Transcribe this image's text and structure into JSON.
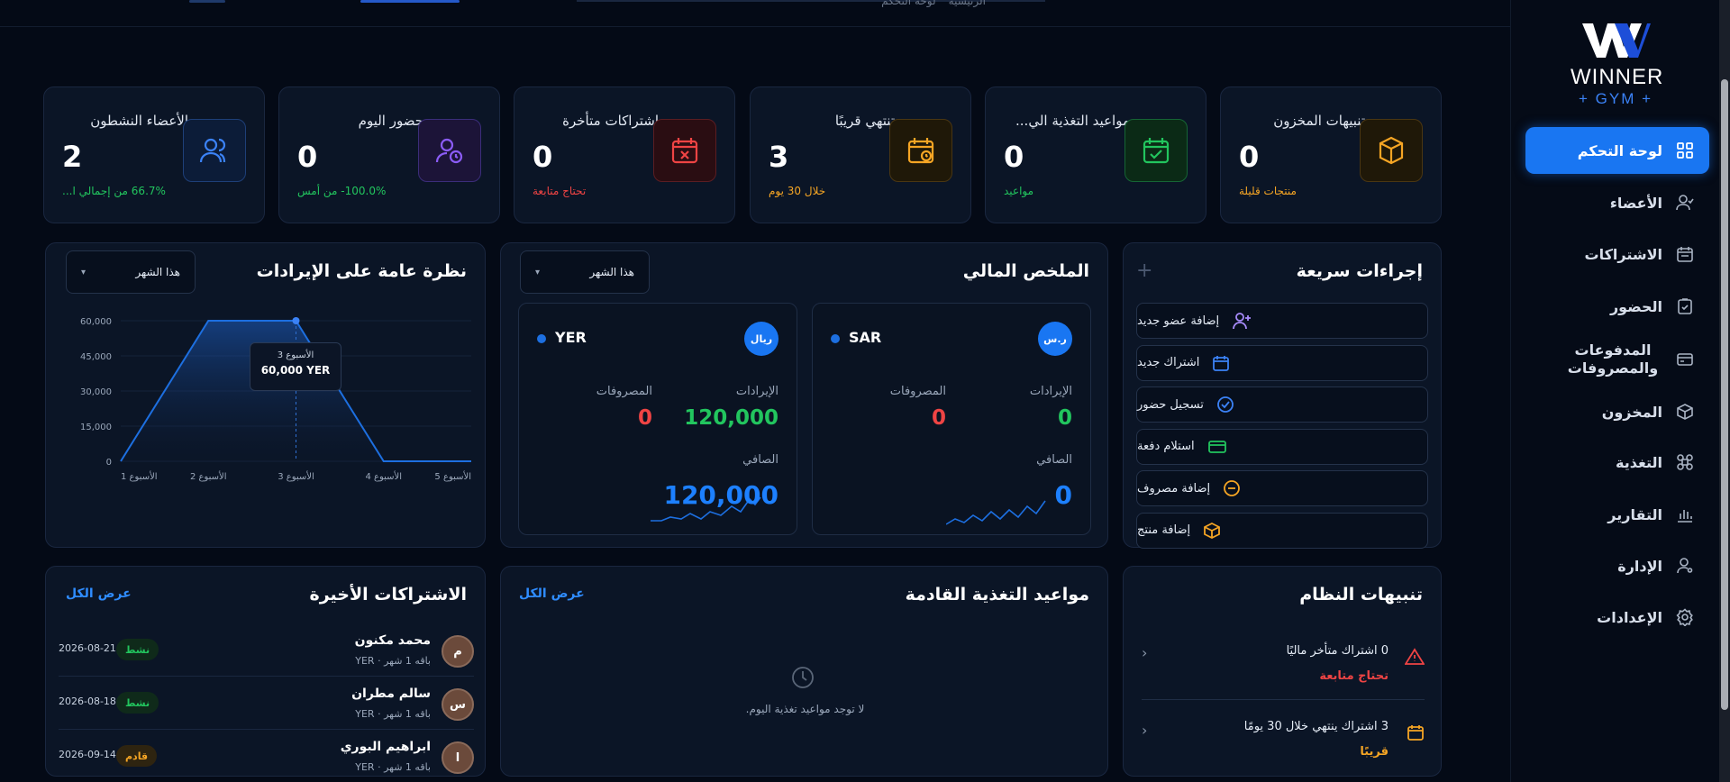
{
  "brand": {
    "logo_text": "WINNER",
    "logo_sub": "+ GYM +"
  },
  "topbar": {
    "breadcrumb_home": "الرئيسية",
    "breadcrumb_current": "لوحة التحكم"
  },
  "sidebar": {
    "items": [
      {
        "label": "لوحة التحكم",
        "icon": "grid-icon"
      },
      {
        "label": "الأعضاء",
        "icon": "user-icon"
      },
      {
        "label": "الاشتراكات",
        "icon": "calendar-icon"
      },
      {
        "label": "الحضور",
        "icon": "clipboard-check-icon"
      },
      {
        "label": "المدفوعات والمصروفات",
        "icon": "card-icon"
      },
      {
        "label": "المخزون",
        "icon": "box-icon"
      },
      {
        "label": "التغذية",
        "icon": "nutrition-icon"
      },
      {
        "label": "التقارير",
        "icon": "bar-chart-icon"
      },
      {
        "label": "الإدارة",
        "icon": "admin-icon"
      },
      {
        "label": "الإعدادات",
        "icon": "gear-icon"
      }
    ]
  },
  "stats": [
    {
      "title": "تنبيهات المخزون",
      "value": "0",
      "sub": "منتجات قليلة",
      "color": "#f5a524"
    },
    {
      "title": "مواعيد التغذية الي...",
      "value": "0",
      "sub": "مواعيد",
      "color": "#22c55e"
    },
    {
      "title": "تنتهي قريبًا",
      "value": "3",
      "sub": "خلال 30 يوم",
      "color": "#f5a524"
    },
    {
      "title": "اشتراكات متأخرة",
      "value": "0",
      "sub": "تحتاج متابعة",
      "color": "#ef4444"
    },
    {
      "title": "حضور اليوم",
      "value": "0",
      "sub": "100.0%- من أمس",
      "color": "#22c55e"
    },
    {
      "title": "الأعضاء النشطون",
      "value": "2",
      "sub": "66.7% من إجمالي ا...",
      "color": "#22c55e"
    }
  ],
  "quick_actions": {
    "title": "إجراءات سريعة",
    "items": [
      {
        "label": "إضافة عضو جديد",
        "icon": "user-plus-icon",
        "color": "#a78bfa"
      },
      {
        "label": "اشتراك جديد",
        "icon": "calendar-icon",
        "color": "#3b82f6"
      },
      {
        "label": "تسجيل حضور",
        "icon": "check-circle-icon",
        "color": "#3b82f6"
      },
      {
        "label": "استلام دفعة",
        "icon": "card-icon",
        "color": "#22c55e"
      },
      {
        "label": "إضافة مصروف",
        "icon": "minus-circle-icon",
        "color": "#f5a524"
      },
      {
        "label": "إضافة منتج",
        "icon": "box-icon",
        "color": "#f5a524"
      }
    ]
  },
  "financial": {
    "title": "الملخص المالي",
    "period": "هذا الشهر",
    "revenue_label": "الإيرادات",
    "expense_label": "المصروفات",
    "net_label": "الصافي",
    "currencies": [
      {
        "code": "SAR",
        "symbol": "ر.س",
        "revenue": "0",
        "expenses": "0",
        "net": "0"
      },
      {
        "code": "YER",
        "symbol": "ريال",
        "revenue": "120,000",
        "expenses": "0",
        "net": "120,000"
      }
    ]
  },
  "revenue_chart": {
    "title": "نظرة عامة على الإيرادات",
    "period": "هذا الشهر",
    "tooltip_week": "الأسبوع 3",
    "tooltip_value": "60,000 YER"
  },
  "chart_data": {
    "type": "area",
    "categories": [
      "الأسبوع 1",
      "الأسبوع 2",
      "الأسبوع 3",
      "الأسبوع 4",
      "الأسبوع 5"
    ],
    "values": [
      0,
      60000,
      60000,
      0,
      0
    ],
    "yticks": [
      "60,000",
      "45,000",
      "30,000",
      "15,000",
      "0"
    ],
    "ylim": [
      0,
      60000
    ],
    "color": "#1d6fe0"
  },
  "alerts": {
    "title": "تنبيهات النظام",
    "items": [
      {
        "text": "0 اشتراك متأخر ماليًا",
        "status": "تحتاج متابعة",
        "color": "#ef4444"
      },
      {
        "text": "3 اشتراك ينتهي خلال 30 يومًا",
        "status": "قريبًا",
        "color": "#f5a524"
      }
    ]
  },
  "nutrition": {
    "title": "مواعيد التغذية القادمة",
    "view_all": "عرض الكل",
    "empty": "لا توجد مواعيد تغذية اليوم."
  },
  "recent_subs": {
    "title": "الاشتراكات الأخيرة",
    "view_all": "عرض الكل",
    "rows": [
      {
        "initial": "م",
        "name": "محمد مكنون",
        "plan": "باقه 1 شهر · YER",
        "status": "نشط",
        "date": "2026-08-21",
        "status_color": "#22c55e",
        "status_bg": "#0f2a1a"
      },
      {
        "initial": "س",
        "name": "سالم مطران",
        "plan": "باقه 1 شهر · YER",
        "status": "نشط",
        "date": "2026-08-18",
        "status_color": "#22c55e",
        "status_bg": "#0f2a1a"
      },
      {
        "initial": "ا",
        "name": "ابراهيم البوري",
        "plan": "باقه 1 شهر · YER",
        "status": "قادم",
        "date": "2026-09-14",
        "status_color": "#f5a524",
        "status_bg": "#2e2410"
      }
    ]
  }
}
